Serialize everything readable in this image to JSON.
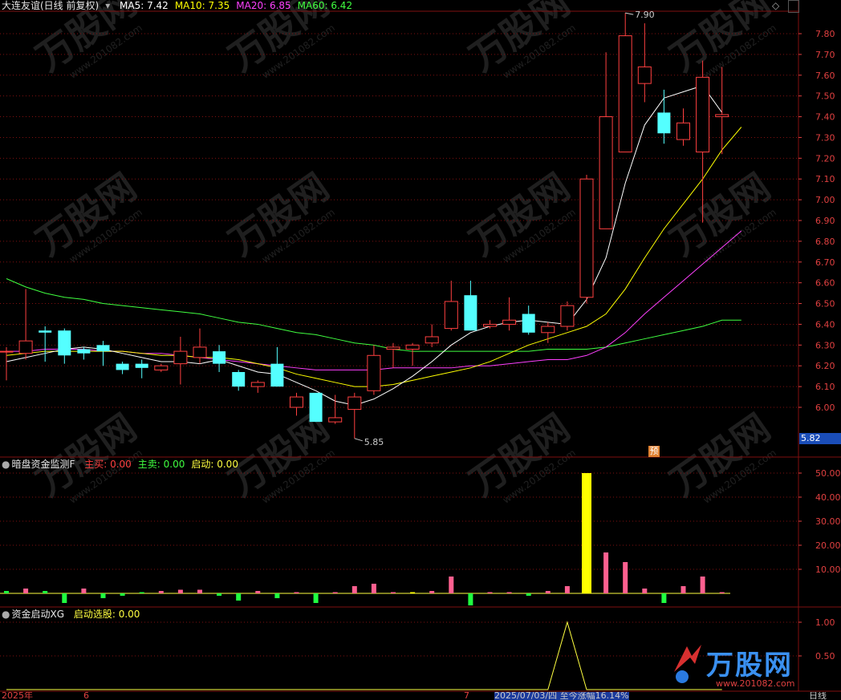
{
  "main_panel": {
    "stock_name": "大连友谊(日线 前复权)",
    "ma_labels": [
      {
        "text": "MA5: 7.42",
        "color": "#ffffff"
      },
      {
        "text": "MA10: 7.35",
        "color": "#ffff00"
      },
      {
        "text": "MA20: 6.85",
        "color": "#ff40ff"
      },
      {
        "text": "MA60: 6.42",
        "color": "#40ff40"
      }
    ],
    "y_ticks": [
      "7.80",
      "7.70",
      "7.60",
      "7.50",
      "7.40",
      "7.30",
      "7.20",
      "7.10",
      "7.00",
      "6.90",
      "6.80",
      "6.70",
      "6.60",
      "6.50",
      "6.40",
      "6.30",
      "6.20",
      "6.10",
      "6.00"
    ],
    "high_marker": "7.90",
    "low_marker": "5.85",
    "current_price": "5.82",
    "forecast_badge": "预"
  },
  "panel2": {
    "indicator_name": "暗盘资金监测F",
    "labels": [
      {
        "text": "主买: 0.00",
        "color": "#ff4040"
      },
      {
        "text": "主卖: 0.00",
        "color": "#40ff40"
      },
      {
        "text": "启动: 0.00",
        "color": "#ffff40"
      }
    ],
    "y_ticks": [
      "50.00",
      "40.00",
      "30.00",
      "20.00",
      "10.00"
    ]
  },
  "panel3": {
    "indicator_name": "资金启动XG",
    "labels": [
      {
        "text": "启动选股: 0.00",
        "color": "#ffff40"
      }
    ],
    "y_ticks": [
      "1.00",
      "0.50"
    ]
  },
  "bottom_bar": {
    "year": "2025年",
    "month_6": "6",
    "month_7": "7",
    "info": "2025/07/03/四 至今涨幅16.14%",
    "period": "日线",
    "watermark_site": "万股网",
    "watermark_url": "www.201082.com"
  },
  "colors": {
    "up": "#ff4040",
    "down": "#54ffff",
    "grid": "#801010",
    "ma5": "#ffffff",
    "ma10": "#ffff00",
    "ma20": "#ff40ff",
    "ma60": "#40ff40"
  },
  "chart_data": {
    "type": "candlestick",
    "price_range": [
      5.82,
      7.9
    ],
    "candles": [
      {
        "o": 6.27,
        "h": 6.29,
        "l": 6.13,
        "c": 6.27
      },
      {
        "o": 6.26,
        "h": 6.57,
        "l": 6.23,
        "c": 6.32
      },
      {
        "o": 6.37,
        "h": 6.39,
        "l": 6.22,
        "c": 6.36
      },
      {
        "o": 6.37,
        "h": 6.38,
        "l": 6.21,
        "c": 6.25
      },
      {
        "o": 6.28,
        "h": 6.29,
        "l": 6.23,
        "c": 6.26
      },
      {
        "o": 6.3,
        "h": 6.32,
        "l": 6.2,
        "c": 6.27
      },
      {
        "o": 6.21,
        "h": 6.22,
        "l": 6.16,
        "c": 6.18
      },
      {
        "o": 6.21,
        "h": 6.23,
        "l": 6.14,
        "c": 6.19
      },
      {
        "o": 6.18,
        "h": 6.21,
        "l": 6.17,
        "c": 6.2
      },
      {
        "o": 6.21,
        "h": 6.34,
        "l": 6.11,
        "c": 6.27
      },
      {
        "o": 6.24,
        "h": 6.38,
        "l": 6.21,
        "c": 6.29
      },
      {
        "o": 6.27,
        "h": 6.3,
        "l": 6.17,
        "c": 6.21
      },
      {
        "o": 6.17,
        "h": 6.18,
        "l": 6.08,
        "c": 6.1
      },
      {
        "o": 6.1,
        "h": 6.13,
        "l": 6.07,
        "c": 6.12
      },
      {
        "o": 6.21,
        "h": 6.29,
        "l": 6.1,
        "c": 6.1
      },
      {
        "o": 6.0,
        "h": 6.07,
        "l": 5.96,
        "c": 6.05
      },
      {
        "o": 6.07,
        "h": 6.07,
        "l": 5.93,
        "c": 5.93
      },
      {
        "o": 5.93,
        "h": 6.06,
        "l": 5.92,
        "c": 5.95
      },
      {
        "o": 5.99,
        "h": 6.07,
        "l": 5.85,
        "c": 6.05
      },
      {
        "o": 6.08,
        "h": 6.3,
        "l": 6.06,
        "c": 6.25
      },
      {
        "o": 6.28,
        "h": 6.31,
        "l": 6.19,
        "c": 6.29
      },
      {
        "o": 6.28,
        "h": 6.31,
        "l": 6.2,
        "c": 6.3
      },
      {
        "o": 6.31,
        "h": 6.4,
        "l": 6.29,
        "c": 6.34
      },
      {
        "o": 6.38,
        "h": 6.61,
        "l": 6.37,
        "c": 6.51
      },
      {
        "o": 6.54,
        "h": 6.61,
        "l": 6.37,
        "c": 6.37
      },
      {
        "o": 6.39,
        "h": 6.42,
        "l": 6.38,
        "c": 6.4
      },
      {
        "o": 6.4,
        "h": 6.53,
        "l": 6.37,
        "c": 6.42
      },
      {
        "o": 6.45,
        "h": 6.49,
        "l": 6.35,
        "c": 6.36
      },
      {
        "o": 6.36,
        "h": 6.41,
        "l": 6.31,
        "c": 6.39
      },
      {
        "o": 6.39,
        "h": 6.51,
        "l": 6.37,
        "c": 6.49
      },
      {
        "o": 6.53,
        "h": 7.12,
        "l": 6.5,
        "c": 7.1
      },
      {
        "o": 6.86,
        "h": 7.71,
        "l": 6.86,
        "c": 7.4
      },
      {
        "o": 7.23,
        "h": 7.9,
        "l": 7.23,
        "c": 7.79
      },
      {
        "o": 7.56,
        "h": 7.85,
        "l": 7.47,
        "c": 7.64
      },
      {
        "o": 7.42,
        "h": 7.53,
        "l": 7.27,
        "c": 7.32
      },
      {
        "o": 7.29,
        "h": 7.44,
        "l": 7.26,
        "c": 7.37
      },
      {
        "o": 7.23,
        "h": 7.67,
        "l": 6.89,
        "c": 7.59
      },
      {
        "o": 7.4,
        "h": 7.64,
        "l": 7.22,
        "c": 7.41
      }
    ],
    "ma5": [
      6.22,
      6.24,
      6.26,
      6.28,
      6.29,
      6.28,
      6.26,
      6.24,
      6.22,
      6.22,
      6.21,
      6.23,
      6.2,
      6.17,
      6.16,
      6.12,
      6.08,
      6.03,
      6.01,
      6.04,
      6.09,
      6.15,
      6.22,
      6.3,
      6.36,
      6.39,
      6.41,
      6.42,
      6.41,
      6.4,
      6.52,
      6.72,
      7.08,
      7.36,
      7.49,
      7.52,
      7.55,
      7.42
    ],
    "ma10": [
      6.25,
      6.26,
      6.27,
      6.27,
      6.27,
      6.27,
      6.27,
      6.26,
      6.25,
      6.25,
      6.24,
      6.24,
      6.23,
      6.21,
      6.19,
      6.16,
      6.14,
      6.12,
      6.1,
      6.1,
      6.11,
      6.13,
      6.15,
      6.17,
      6.19,
      6.22,
      6.26,
      6.3,
      6.33,
      6.36,
      6.39,
      6.45,
      6.57,
      6.72,
      6.86,
      6.98,
      7.1,
      7.24,
      7.35
    ],
    "ma20": [
      6.27,
      6.27,
      6.28,
      6.28,
      6.28,
      6.27,
      6.27,
      6.26,
      6.26,
      6.25,
      6.24,
      6.23,
      6.22,
      6.21,
      6.2,
      6.19,
      6.18,
      6.18,
      6.18,
      6.18,
      6.19,
      6.19,
      6.19,
      6.19,
      6.2,
      6.2,
      6.21,
      6.22,
      6.23,
      6.23,
      6.25,
      6.29,
      6.36,
      6.45,
      6.53,
      6.61,
      6.69,
      6.77,
      6.85
    ],
    "ma60": [
      6.62,
      6.58,
      6.55,
      6.53,
      6.52,
      6.5,
      6.49,
      6.48,
      6.47,
      6.46,
      6.45,
      6.43,
      6.41,
      6.4,
      6.38,
      6.36,
      6.35,
      6.33,
      6.31,
      6.3,
      6.28,
      6.27,
      6.27,
      6.27,
      6.27,
      6.27,
      6.27,
      6.27,
      6.28,
      6.28,
      6.28,
      6.29,
      6.31,
      6.33,
      6.35,
      6.37,
      6.39,
      6.42,
      6.42
    ],
    "volume_bars": [
      {
        "v": 1,
        "c": "g"
      },
      {
        "v": 2,
        "c": "r"
      },
      {
        "v": 1,
        "c": "g"
      },
      {
        "v": -4,
        "c": "g"
      },
      {
        "v": 2,
        "c": "r"
      },
      {
        "v": -2,
        "c": "g"
      },
      {
        "v": -1,
        "c": "g"
      },
      {
        "v": 0.5,
        "c": "g"
      },
      {
        "v": 1,
        "c": "r"
      },
      {
        "v": 1.5,
        "c": "r"
      },
      {
        "v": 1.5,
        "c": "r"
      },
      {
        "v": -1,
        "c": "g"
      },
      {
        "v": -3,
        "c": "g"
      },
      {
        "v": 1,
        "c": "r"
      },
      {
        "v": -2,
        "c": "g"
      },
      {
        "v": 0.5,
        "c": "r"
      },
      {
        "v": -4,
        "c": "g"
      },
      {
        "v": 0.5,
        "c": "r"
      },
      {
        "v": 3,
        "c": "r"
      },
      {
        "v": 4,
        "c": "r"
      },
      {
        "v": 0.5,
        "c": "r"
      },
      {
        "v": 0.5,
        "c": "y"
      },
      {
        "v": 1,
        "c": "r"
      },
      {
        "v": 7,
        "c": "r"
      },
      {
        "v": -5,
        "c": "g"
      },
      {
        "v": 0.5,
        "c": "r"
      },
      {
        "v": 0.5,
        "c": "r"
      },
      {
        "v": -1,
        "c": "g"
      },
      {
        "v": 1,
        "c": "r"
      },
      {
        "v": 3,
        "c": "r"
      },
      {
        "v": 50,
        "c": "y"
      },
      {
        "v": 17,
        "c": "r"
      },
      {
        "v": 13,
        "c": "r"
      },
      {
        "v": 2,
        "c": "r"
      },
      {
        "v": -4,
        "c": "g"
      },
      {
        "v": 3,
        "c": "r"
      },
      {
        "v": 7,
        "c": "r"
      },
      {
        "v": 0.5,
        "c": "r"
      }
    ],
    "signal": [
      0,
      0,
      0,
      0,
      0,
      0,
      0,
      0,
      0,
      0,
      0,
      0,
      0,
      0,
      0,
      0,
      0,
      0,
      0,
      0,
      0,
      0,
      0,
      0,
      0,
      0,
      0,
      0,
      0,
      1,
      0,
      0,
      0,
      0,
      0,
      0,
      0,
      0
    ]
  }
}
